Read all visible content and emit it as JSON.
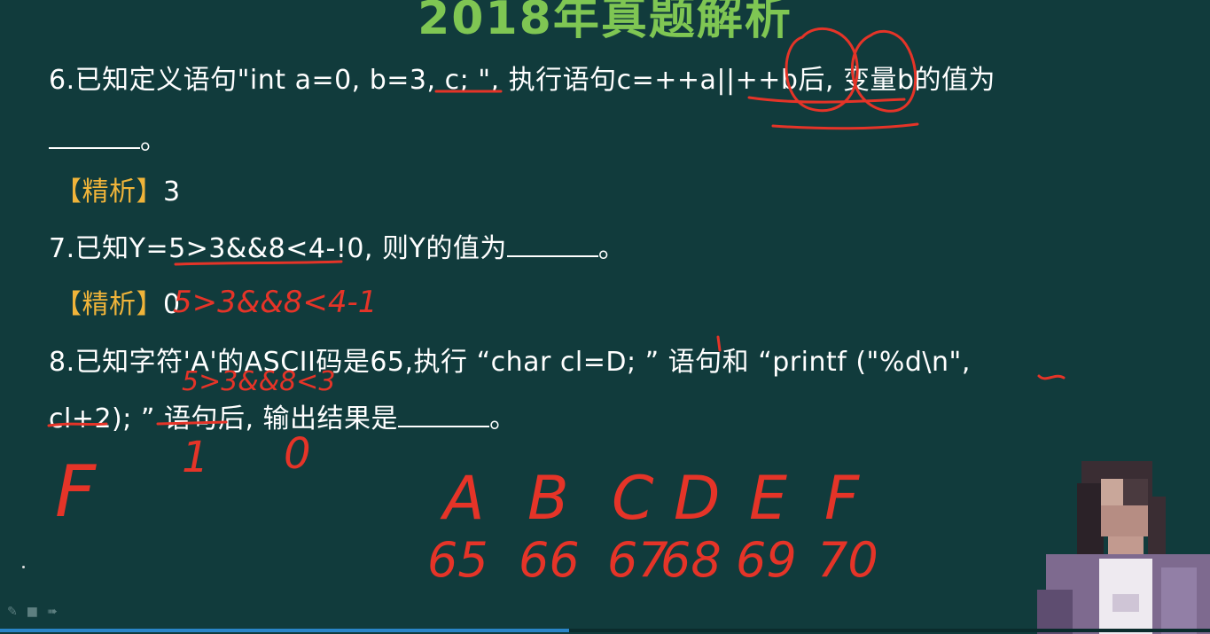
{
  "slide": {
    "title": "2018年真题解析",
    "q6_line1": "6.已知定义语句\"int a=0, b=3, c; \", 执行语句c=++a||++b后, 变量b的值为",
    "q6_blank_suffix": "。",
    "q6_analysis_label": "【精析】",
    "q6_answer": "3",
    "q7_line": "7.已知Y=5>3&&8<4-!0, 则Y的值为",
    "q7_blank_suffix": "。",
    "q7_analysis_label": "【精析】",
    "q7_answer": "0",
    "q8_line1": "8.已知字符'A'的ASCII码是65,执行 “char cl=D; ” 语句和 “printf (\"%d\\n\",",
    "q8_line2": "cl+2); ” 语句后, 输出结果是",
    "q8_blank_suffix": "。"
  },
  "handwriting": {
    "q7_work": "5>3&&8<4-1",
    "q8_work": "5>3&&8<3",
    "digit_one": "1",
    "digit_zero": "0",
    "letter_f": "F",
    "letters": [
      "A",
      "B",
      "C",
      "D",
      "E",
      "F"
    ],
    "codes": [
      "65",
      "66",
      "67",
      "68",
      "69",
      "70"
    ],
    "ink_color": "#e53428"
  },
  "player": {
    "pen_icon": "pen-icon",
    "screen_icon": "screen-icon",
    "forward_icon": "forward-icon",
    "progress_fraction": 0.47
  },
  "colors": {
    "background": "#113b3c",
    "title": "#7fc653",
    "analysis_label": "#f0b43a",
    "progress": "#2a85c8"
  }
}
